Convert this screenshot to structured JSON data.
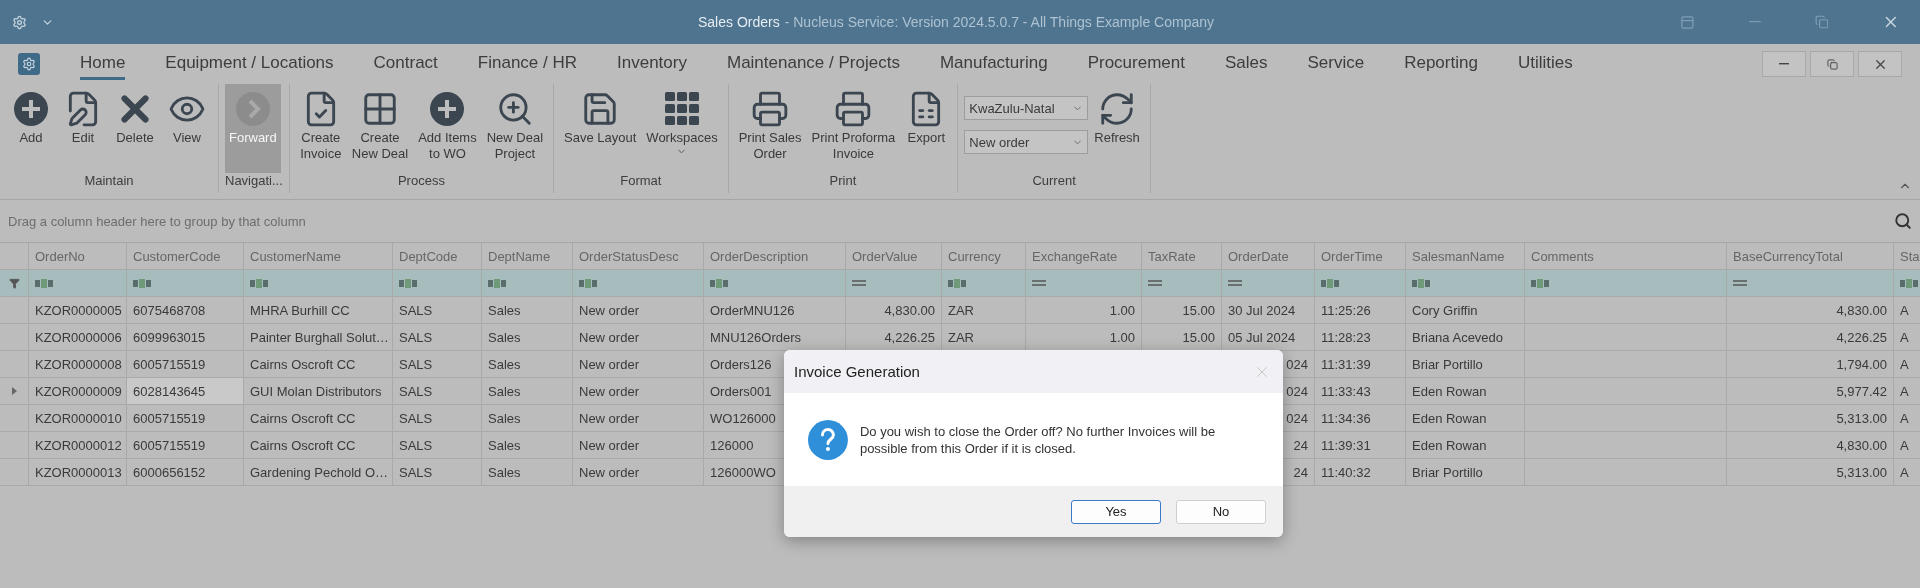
{
  "window": {
    "title": "Sales Orders",
    "subtitle": "- Nucleus Service: Version 2024.5.0.7 - All Things Example Company"
  },
  "ribbon": {
    "tabs": [
      {
        "label": "Home",
        "selected": true
      },
      {
        "label": "Equipment / Locations",
        "selected": false
      },
      {
        "label": "Contract",
        "selected": false
      },
      {
        "label": "Finance / HR",
        "selected": false
      },
      {
        "label": "Inventory",
        "selected": false
      },
      {
        "label": "Maintenance / Projects",
        "selected": false
      },
      {
        "label": "Manufacturing",
        "selected": false
      },
      {
        "label": "Procurement",
        "selected": false
      },
      {
        "label": "Sales",
        "selected": false
      },
      {
        "label": "Service",
        "selected": false
      },
      {
        "label": "Reporting",
        "selected": false
      },
      {
        "label": "Utilities",
        "selected": false
      }
    ],
    "groups": [
      {
        "label": "Maintain",
        "items": [
          {
            "kind": "button",
            "label": "Add",
            "disabled": false
          },
          {
            "kind": "button",
            "label": "Edit",
            "disabled": false
          },
          {
            "kind": "button",
            "label": "Delete",
            "disabled": false
          },
          {
            "kind": "button",
            "label": "View",
            "disabled": false
          }
        ]
      },
      {
        "label": "Navigati...",
        "items": [
          {
            "kind": "button",
            "label": "Forward",
            "disabled": true
          }
        ]
      },
      {
        "label": "Process",
        "items": [
          {
            "kind": "button",
            "label": "Create\nInvoice",
            "disabled": false
          },
          {
            "kind": "button",
            "label": "Create\nNew Deal",
            "disabled": false
          },
          {
            "kind": "button",
            "label": "Add Items\nto WO",
            "disabled": false
          },
          {
            "kind": "button",
            "label": "New Deal\nProject",
            "disabled": false
          }
        ]
      },
      {
        "label": "Format",
        "items": [
          {
            "kind": "button",
            "label": "Save Layout",
            "disabled": false
          },
          {
            "kind": "menu",
            "label": "Workspaces",
            "disabled": false
          }
        ]
      },
      {
        "label": "Print",
        "items": [
          {
            "kind": "button",
            "label": "Print Sales\nOrder",
            "disabled": false
          },
          {
            "kind": "button",
            "label": "Print Proforma\nInvoice",
            "disabled": false
          },
          {
            "kind": "button",
            "label": "Export",
            "disabled": false
          }
        ]
      },
      {
        "label": "Current",
        "items": [
          {
            "kind": "combo",
            "label": "KwaZulu-Natal",
            "disabled": false
          },
          {
            "kind": "combo",
            "label": "New order",
            "disabled": false
          },
          {
            "kind": "button",
            "label": "Refresh",
            "disabled": false
          }
        ]
      }
    ]
  },
  "grid": {
    "group_hint": "Drag a column header here to group by that column",
    "columns": [
      {
        "name": "OrderNo",
        "kind": "text"
      },
      {
        "name": "CustomerCode",
        "kind": "text"
      },
      {
        "name": "CustomerName",
        "kind": "text"
      },
      {
        "name": "DeptCode",
        "kind": "text"
      },
      {
        "name": "DeptName",
        "kind": "text"
      },
      {
        "name": "OrderStatusDesc",
        "kind": "text"
      },
      {
        "name": "OrderDescription",
        "kind": "text"
      },
      {
        "name": "OrderValue",
        "kind": "number"
      },
      {
        "name": "Currency",
        "kind": "text"
      },
      {
        "name": "ExchangeRate",
        "kind": "number"
      },
      {
        "name": "TaxRate",
        "kind": "number"
      },
      {
        "name": "OrderDate",
        "kind": "date"
      },
      {
        "name": "OrderTime",
        "kind": "text"
      },
      {
        "name": "SalesmanName",
        "kind": "text"
      },
      {
        "name": "Comments",
        "kind": "text"
      },
      {
        "name": "BaseCurrencyTotal",
        "kind": "number"
      },
      {
        "name": "Sta",
        "kind": "text"
      }
    ],
    "rows": [
      {
        "selected": false,
        "clipped": false,
        "cells": [
          "KZOR0000005",
          "6075468708",
          "MHRA Burhill CC",
          "SALS",
          "Sales",
          "New order",
          "OrderMNU126",
          "4,830.00",
          "ZAR",
          "1.00",
          "15.00",
          "30 Jul 2024",
          "11:25:26",
          "Cory Griffin",
          null,
          "4,830.00",
          "A"
        ]
      },
      {
        "selected": false,
        "clipped": false,
        "cells": [
          "KZOR0000006",
          "6099963015",
          "Painter Burghall Solut…",
          "SALS",
          "Sales",
          "New order",
          "MNU126Orders",
          "4,226.25",
          "ZAR",
          "1.00",
          "15.00",
          "05 Jul 2024",
          "11:28:23",
          "Briana Acevedo",
          null,
          "4,226.25",
          "A"
        ]
      },
      {
        "selected": false,
        "clipped": true,
        "cells": [
          "KZOR0000008",
          "6005715519",
          "Cairns Oscroft CC",
          "SALS",
          "Sales",
          "New order",
          "Orders126",
          null,
          null,
          null,
          null,
          "024",
          "11:31:39",
          "Briar Portillo",
          null,
          "1,794.00",
          "A"
        ]
      },
      {
        "selected": true,
        "clipped": true,
        "cells": [
          "KZOR0000009",
          "6028143645",
          "GUI Molan Distributors",
          "SALS",
          "Sales",
          "New order",
          "Orders001",
          null,
          null,
          null,
          null,
          "024",
          "11:33:43",
          "Eden Rowan",
          null,
          "5,977.42",
          "A"
        ]
      },
      {
        "selected": false,
        "clipped": true,
        "cells": [
          "KZOR0000010",
          "6005715519",
          "Cairns Oscroft CC",
          "SALS",
          "Sales",
          "New order",
          "WO126000",
          null,
          null,
          null,
          null,
          "024",
          "11:34:36",
          "Eden Rowan",
          null,
          "5,313.00",
          "A"
        ]
      },
      {
        "selected": false,
        "clipped": true,
        "cells": [
          "KZOR0000012",
          "6005715519",
          "Cairns Oscroft CC",
          "SALS",
          "Sales",
          "New order",
          "126000",
          null,
          null,
          null,
          null,
          "24",
          "11:39:31",
          "Eden Rowan",
          null,
          "4,830.00",
          "A"
        ]
      },
      {
        "selected": false,
        "clipped": true,
        "cells": [
          "KZOR0000013",
          "6000656152",
          "Gardening Pechold O…",
          "SALS",
          "Sales",
          "New order",
          "126000WO",
          null,
          null,
          null,
          null,
          "24",
          "11:40:32",
          "Briar Portillo",
          null,
          "5,313.00",
          "A"
        ]
      }
    ]
  },
  "dialog": {
    "title": "Invoice Generation",
    "message": "Do you wish to close the Order off? No further Invoices will be possible from this Order if it is closed.",
    "buttons": [
      {
        "label": "Yes",
        "focused": true
      },
      {
        "label": "No",
        "focused": false
      }
    ]
  }
}
